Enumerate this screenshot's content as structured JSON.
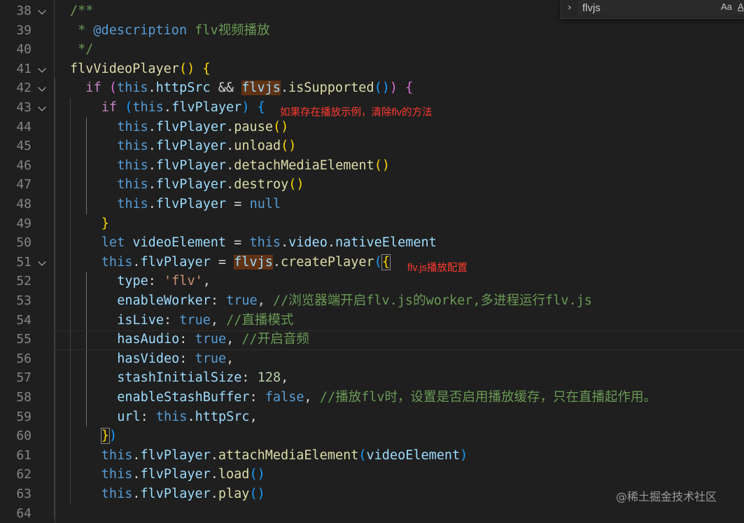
{
  "lines": [
    {
      "num": "38",
      "fold": true,
      "indent": 1,
      "tokens": [
        [
          "/**",
          "cm"
        ]
      ]
    },
    {
      "num": "39",
      "fold": false,
      "indent": 1,
      "tokens": [
        [
          " * ",
          "cm"
        ],
        [
          "@description",
          "cmk"
        ],
        [
          " flv视频播放",
          "cm"
        ]
      ]
    },
    {
      "num": "40",
      "fold": false,
      "indent": 1,
      "tokens": [
        [
          " */",
          "cm"
        ]
      ]
    },
    {
      "num": "41",
      "fold": true,
      "indent": 1,
      "tokens": [
        [
          "flvVideoPlayer",
          "fn"
        ],
        [
          "()",
          "b1"
        ],
        [
          " ",
          "pn"
        ],
        [
          "{",
          "b1"
        ]
      ]
    },
    {
      "num": "42",
      "fold": true,
      "indent": 2,
      "tokens": [
        [
          "if",
          "kw"
        ],
        [
          " ",
          "pn"
        ],
        [
          "(",
          "b2"
        ],
        [
          "this",
          "kb"
        ],
        [
          ".",
          "pn"
        ],
        [
          "httpSrc",
          "pr"
        ],
        [
          " && ",
          "pn"
        ],
        [
          "flvjs",
          "pr hl"
        ],
        [
          ".",
          "pn"
        ],
        [
          "isSupported",
          "fn"
        ],
        [
          "()",
          "b3"
        ],
        [
          ")",
          "b2"
        ],
        [
          " ",
          "pn"
        ],
        [
          "{",
          "b2"
        ]
      ]
    },
    {
      "num": "43",
      "fold": true,
      "indent": 3,
      "tokens": [
        [
          "if",
          "kw"
        ],
        [
          " ",
          "pn"
        ],
        [
          "(",
          "b3"
        ],
        [
          "this",
          "kb"
        ],
        [
          ".",
          "pn"
        ],
        [
          "flvPlayer",
          "pr"
        ],
        [
          ")",
          "b3"
        ],
        [
          " ",
          "pn"
        ],
        [
          "{",
          "b3"
        ]
      ]
    },
    {
      "num": "44",
      "fold": false,
      "indent": 4,
      "tokens": [
        [
          "this",
          "kb"
        ],
        [
          ".",
          "pn"
        ],
        [
          "flvPlayer",
          "pr"
        ],
        [
          ".",
          "pn"
        ],
        [
          "pause",
          "fn"
        ],
        [
          "()",
          "b1"
        ]
      ]
    },
    {
      "num": "45",
      "fold": false,
      "indent": 4,
      "tokens": [
        [
          "this",
          "kb"
        ],
        [
          ".",
          "pn"
        ],
        [
          "flvPlayer",
          "pr"
        ],
        [
          ".",
          "pn"
        ],
        [
          "unload",
          "fn"
        ],
        [
          "()",
          "b1"
        ]
      ]
    },
    {
      "num": "46",
      "fold": false,
      "indent": 4,
      "tokens": [
        [
          "this",
          "kb"
        ],
        [
          ".",
          "pn"
        ],
        [
          "flvPlayer",
          "pr"
        ],
        [
          ".",
          "pn"
        ],
        [
          "detachMediaElement",
          "fn"
        ],
        [
          "()",
          "b1"
        ]
      ]
    },
    {
      "num": "47",
      "fold": false,
      "indent": 4,
      "tokens": [
        [
          "this",
          "kb"
        ],
        [
          ".",
          "pn"
        ],
        [
          "flvPlayer",
          "pr"
        ],
        [
          ".",
          "pn"
        ],
        [
          "destroy",
          "fn"
        ],
        [
          "()",
          "b1"
        ]
      ]
    },
    {
      "num": "48",
      "fold": false,
      "indent": 4,
      "tokens": [
        [
          "this",
          "kb"
        ],
        [
          ".",
          "pn"
        ],
        [
          "flvPlayer",
          "pr"
        ],
        [
          " = ",
          "pn"
        ],
        [
          "null",
          "kb"
        ]
      ]
    },
    {
      "num": "49",
      "fold": false,
      "indent": 3,
      "tokens": [
        [
          "}",
          "b1"
        ]
      ]
    },
    {
      "num": "50",
      "fold": false,
      "indent": 3,
      "tokens": [
        [
          "let",
          "kb"
        ],
        [
          " ",
          "pn"
        ],
        [
          "videoElement",
          "pr"
        ],
        [
          " = ",
          "pn"
        ],
        [
          "this",
          "kb"
        ],
        [
          ".",
          "pn"
        ],
        [
          "video",
          "pr"
        ],
        [
          ".",
          "pn"
        ],
        [
          "nativeElement",
          "pr"
        ]
      ]
    },
    {
      "num": "51",
      "fold": true,
      "indent": 3,
      "tokens": [
        [
          "this",
          "kb"
        ],
        [
          ".",
          "pn"
        ],
        [
          "flvPlayer",
          "pr"
        ],
        [
          " = ",
          "pn"
        ],
        [
          "flvjs",
          "pr hl"
        ],
        [
          ".",
          "pn"
        ],
        [
          "createPlayer",
          "fn"
        ],
        [
          "(",
          "b3"
        ],
        [
          "{",
          "b1 bm"
        ]
      ]
    },
    {
      "num": "52",
      "fold": false,
      "indent": 4,
      "tokens": [
        [
          "type",
          "pr"
        ],
        [
          ": ",
          "pn"
        ],
        [
          "'flv'",
          "st"
        ],
        [
          ",",
          "pn"
        ]
      ]
    },
    {
      "num": "53",
      "fold": false,
      "indent": 4,
      "tokens": [
        [
          "enableWorker",
          "pr"
        ],
        [
          ": ",
          "pn"
        ],
        [
          "true",
          "kb"
        ],
        [
          ", ",
          "pn"
        ],
        [
          "//浏览器端开启flv.js的worker,多进程运行flv.js",
          "cm"
        ]
      ]
    },
    {
      "num": "54",
      "fold": false,
      "indent": 4,
      "tokens": [
        [
          "isLive",
          "pr"
        ],
        [
          ": ",
          "pn"
        ],
        [
          "true",
          "kb"
        ],
        [
          ", ",
          "pn"
        ],
        [
          "//直播模式",
          "cm"
        ]
      ]
    },
    {
      "num": "55",
      "fold": false,
      "indent": 4,
      "tokens": [
        [
          "hasAudio",
          "pr"
        ],
        [
          ": ",
          "pn"
        ],
        [
          "true",
          "kb"
        ],
        [
          ", ",
          "pn"
        ],
        [
          "//开启音频",
          "cm"
        ]
      ]
    },
    {
      "num": "56",
      "fold": false,
      "indent": 4,
      "tokens": [
        [
          "hasVideo",
          "pr"
        ],
        [
          ": ",
          "pn"
        ],
        [
          "true",
          "kb"
        ],
        [
          ",",
          "pn"
        ]
      ]
    },
    {
      "num": "57",
      "fold": false,
      "indent": 4,
      "tokens": [
        [
          "stashInitialSize",
          "pr"
        ],
        [
          ": ",
          "pn"
        ],
        [
          "128",
          "nm"
        ],
        [
          ",",
          "pn"
        ]
      ]
    },
    {
      "num": "58",
      "fold": false,
      "indent": 4,
      "tokens": [
        [
          "enableStashBuffer",
          "pr"
        ],
        [
          ": ",
          "pn"
        ],
        [
          "false",
          "kb"
        ],
        [
          ", ",
          "pn"
        ],
        [
          "//播放flv时，设置是否启用播放缓存，只在直播起作用。",
          "cm"
        ]
      ]
    },
    {
      "num": "59",
      "fold": false,
      "indent": 4,
      "tokens": [
        [
          "url",
          "pr"
        ],
        [
          ": ",
          "pn"
        ],
        [
          "this",
          "kb"
        ],
        [
          ".",
          "pn"
        ],
        [
          "httpSrc",
          "pr"
        ],
        [
          ",",
          "pn"
        ]
      ]
    },
    {
      "num": "60",
      "fold": false,
      "indent": 3,
      "tokens": [
        [
          "}",
          "b1 bm"
        ],
        [
          ")",
          "b3"
        ]
      ]
    },
    {
      "num": "61",
      "fold": false,
      "indent": 3,
      "tokens": [
        [
          "this",
          "kb"
        ],
        [
          ".",
          "pn"
        ],
        [
          "flvPlayer",
          "pr"
        ],
        [
          ".",
          "pn"
        ],
        [
          "attachMediaElement",
          "fn"
        ],
        [
          "(",
          "b3"
        ],
        [
          "videoElement",
          "pr"
        ],
        [
          ")",
          "b3"
        ]
      ]
    },
    {
      "num": "62",
      "fold": false,
      "indent": 3,
      "tokens": [
        [
          "this",
          "kb"
        ],
        [
          ".",
          "pn"
        ],
        [
          "flvPlayer",
          "pr"
        ],
        [
          ".",
          "pn"
        ],
        [
          "load",
          "fn"
        ],
        [
          "()",
          "b3"
        ]
      ]
    },
    {
      "num": "63",
      "fold": false,
      "indent": 3,
      "tokens": [
        [
          "this",
          "kb"
        ],
        [
          ".",
          "pn"
        ],
        [
          "flvPlayer",
          "pr"
        ],
        [
          ".",
          "pn"
        ],
        [
          "play",
          "fn"
        ],
        [
          "()",
          "b3"
        ]
      ]
    },
    {
      "num": "64",
      "fold": false,
      "indent": 2,
      "tokens": []
    }
  ],
  "annotations": {
    "clear_note": "如果存在播放示例，清除flv的方法",
    "config_note": "flv.js播放配置"
  },
  "find_widget": {
    "toggle_glyph": "›",
    "query": "flvjs",
    "match_case_label": "Aa",
    "whole_word_label": "A"
  },
  "watermark": "@稀土掘金技术社区",
  "colors": {
    "background": "#1f1f1f",
    "annotation": "#ff3b30",
    "match_highlight": "#613214"
  }
}
